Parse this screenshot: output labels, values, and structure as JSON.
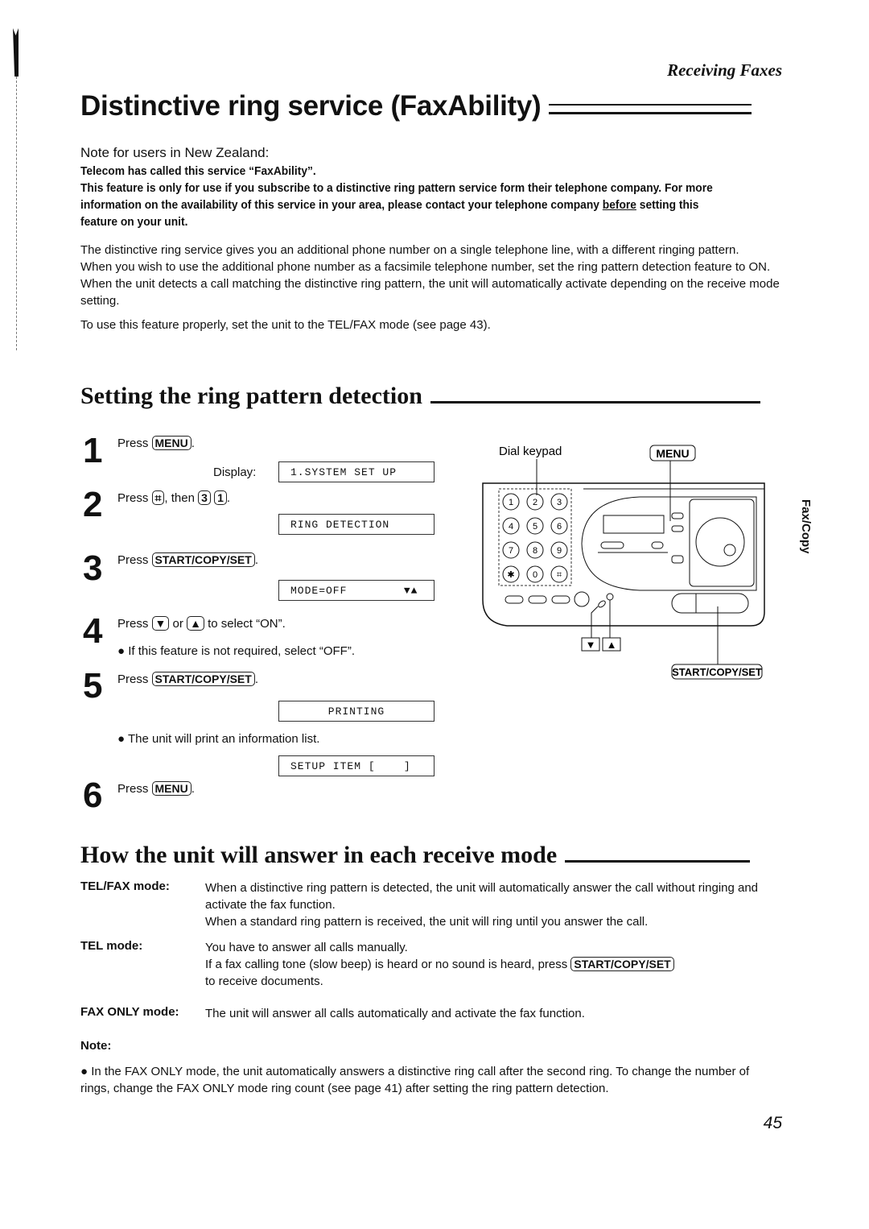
{
  "section_header": "Receiving Faxes",
  "title": "Distinctive ring service (FaxAbility)",
  "nz_note": {
    "heading": "Note for users in New Zealand:",
    "lines": [
      "Telecom has called this service “FaxAbility”.",
      "This feature is only for use if you subscribe to a distinctive ring pattern service form their telephone company. For more information on the availability of this service in your area, please contact your telephone company",
      "before",
      "setting this feature on your unit."
    ]
  },
  "intro": [
    "The distinctive ring service gives you an additional phone number on a single telephone line, with a different ringing pattern.",
    "When you wish to use the additional phone number as a facsimile telephone number, set the ring pattern detection feature to ON. When the unit detects a call matching the distinctive ring pattern, the unit will automatically activate depending on the receive mode setting.",
    "To use this feature properly, set the unit to the TEL/FAX mode (see page 43)."
  ],
  "setting_section": {
    "heading": "Setting the ring pattern detection",
    "steps": [
      {
        "num": "1",
        "pre": "Press",
        "keys": [
          "MENU"
        ],
        "post": ".",
        "display_label": "Display:",
        "display": "1.SYSTEM SET UP"
      },
      {
        "num": "2",
        "pre": "Press",
        "keys": [
          "⌗"
        ],
        "mid": ", then",
        "keys2": [
          "3",
          "1"
        ],
        "post": ".",
        "display": "RING DETECTION"
      },
      {
        "num": "3",
        "pre": "Press",
        "keys": [
          "START/COPY/SET"
        ],
        "post": ".",
        "display": "MODE=OFF        ▼▲"
      },
      {
        "num": "4",
        "pre": "Press",
        "keys": [
          "▼"
        ],
        "mid": "or",
        "keys2": [
          "▲"
        ],
        "post": "to select “ON”.",
        "bullet": "If this feature is not required, select “OFF”."
      },
      {
        "num": "5",
        "pre": "Press",
        "keys": [
          "START/COPY/SET"
        ],
        "post": ".",
        "display": "PRINTING",
        "bullet": "The unit will print an information list.",
        "display2": "SETUP ITEM [    ]"
      },
      {
        "num": "6",
        "pre": "Press",
        "keys": [
          "MENU"
        ],
        "post": "."
      }
    ]
  },
  "diagram": {
    "dial_keypad_label": "Dial keypad",
    "menu_label": "MENU",
    "start_label": "START/COPY/SET",
    "down_label": "▼",
    "up_label": "▲",
    "keys": [
      "1",
      "2",
      "3",
      "4",
      "5",
      "6",
      "7",
      "8",
      "9",
      "✱",
      "0",
      "⌗"
    ]
  },
  "answer_section": {
    "heading": "How the unit will answer in each receive mode",
    "modes": [
      {
        "label": "TEL/FAX mode:",
        "lines": [
          "When a distinctive ring pattern is detected, the unit will automatically answer the call without ringing and activate the fax function.",
          "When a standard ring pattern is received, the unit will ring until you answer the call."
        ]
      },
      {
        "label": "TEL mode:",
        "lines": [
          "You have to answer all calls manually.",
          "If a fax calling tone (slow beep) is heard or no sound is heard, press",
          "START/COPY/SET",
          "to receive documents."
        ]
      },
      {
        "label": "FAX ONLY mode:",
        "lines": [
          "The unit will answer all calls automatically and activate the fax function."
        ]
      }
    ],
    "note_label": "Note:",
    "note_bullet": "In the FAX ONLY mode, the unit automatically answers a distinctive ring call after the second ring. To change the number of rings, change the FAX ONLY mode ring count (see page 41) after setting the ring pattern detection."
  },
  "side_tab": "Fax/Copy",
  "page_number": "45"
}
